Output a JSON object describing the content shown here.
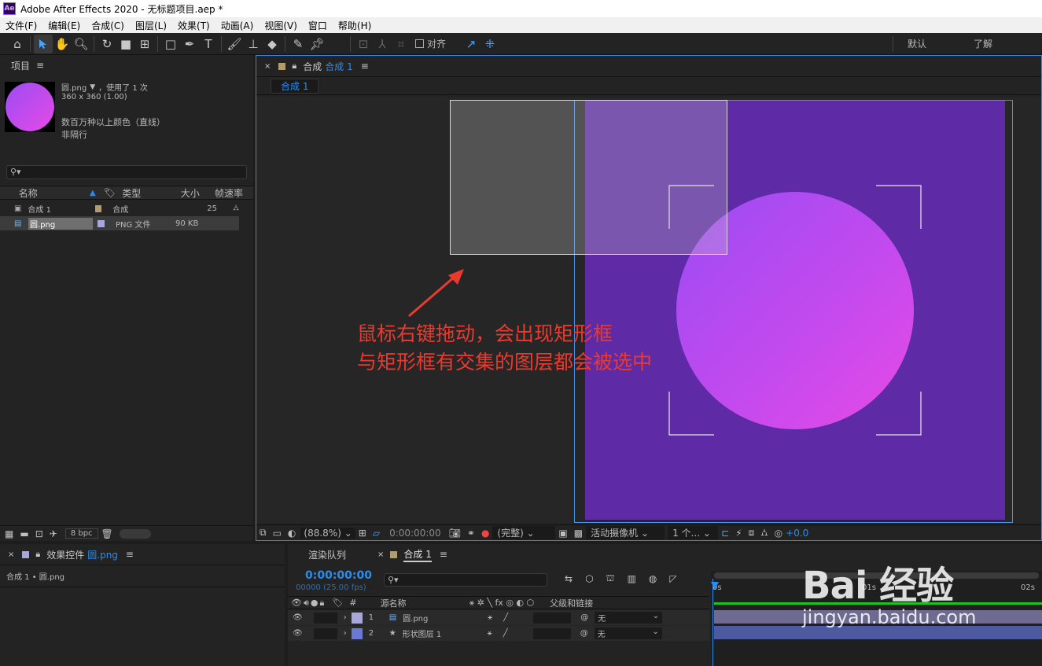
{
  "window": {
    "app_icon": "Ae",
    "title": "Adobe After Effects 2020 - 无标题项目.aep *"
  },
  "menu": [
    "文件(F)",
    "编辑(E)",
    "合成(C)",
    "图层(L)",
    "效果(T)",
    "动画(A)",
    "视图(V)",
    "窗口",
    "帮助(H)"
  ],
  "toolbar": {
    "snap_label": "对齐",
    "workspace_default": "默认",
    "workspace_learn": "了解"
  },
  "project": {
    "tab": "项目",
    "selected_name": "圆.png",
    "used": "，使用了 1 次",
    "dims": "360 x 360 (1.00)",
    "colors": "数百万种以上颜色（直线）",
    "interlace": "非隔行",
    "columns": {
      "name": "名称",
      "type": "类型",
      "size": "大小",
      "fps": "帧速率"
    },
    "items": [
      {
        "name": "合成 1",
        "type": "合成",
        "size": "",
        "fps": "25",
        "color": "#b29b6e"
      },
      {
        "name": "圆.png",
        "type": "PNG 文件",
        "size": "90 KB",
        "fps": "",
        "color": "#a9a6d9"
      }
    ],
    "bpc": "8 bpc"
  },
  "composition": {
    "tab_prefix": "合成",
    "tab_name": "合成 1",
    "breadcrumb": "合成 1",
    "annotation_line1": "鼠标右键拖动，会出现矩形框",
    "annotation_line2": "与矩形框有交集的图层都会被选中",
    "colors": {
      "comp_bg": "#5e2aa6",
      "circle_from": "#9b4cf4",
      "circle_to": "#e74ae6",
      "annotation": "#e83a2f"
    },
    "bottom": {
      "zoom": "(88.8%)",
      "time": "0:00:00:00",
      "quality": "(完整)",
      "camera": "活动摄像机",
      "views": "1 个...",
      "exposure": "+0.0"
    }
  },
  "effects": {
    "tab_prefix": "效果控件",
    "tab_name": "圆.png",
    "path": "合成 1 • 圆.png"
  },
  "timeline": {
    "tab_render": "渲染队列",
    "tab_comp": "合成 1",
    "timecode": "0:00:00:00",
    "frames": "00000 (25.00 fps)",
    "col_source": "源名称",
    "col_parent": "父级和链接",
    "layers": [
      {
        "num": "1",
        "name": "圆.png",
        "color": "#a9a6d9",
        "parent": "无"
      },
      {
        "num": "2",
        "name": "形状图层 1",
        "color": "#6a79d4",
        "parent": "无"
      }
    ],
    "ruler": [
      "0s",
      "01s",
      "02s"
    ]
  },
  "watermark": {
    "line1": "Bai 经验",
    "line2": "jingyan.baidu.com"
  }
}
